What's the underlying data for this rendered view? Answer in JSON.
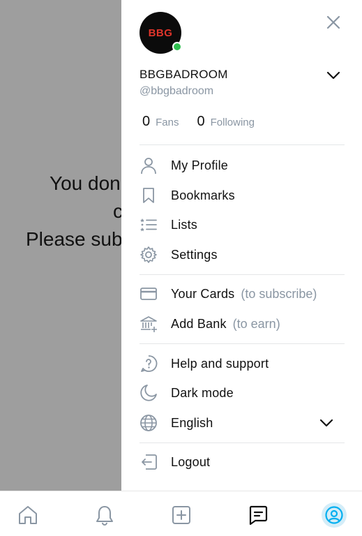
{
  "background": {
    "line1": "You don",
    "line2": "c",
    "line3": "Please sub"
  },
  "drawer": {
    "avatar_text": "BBG",
    "display_name": "BBGBADROOM",
    "username": "@bbgbadroom",
    "stats": {
      "fans_count": "0",
      "fans_label": "Fans",
      "following_count": "0",
      "following_label": "Following"
    },
    "menu": {
      "my_profile": "My Profile",
      "bookmarks": "Bookmarks",
      "lists": "Lists",
      "settings": "Settings",
      "your_cards": "Your Cards",
      "your_cards_sub": "(to subscribe)",
      "add_bank": "Add Bank",
      "add_bank_sub": "(to earn)",
      "help": "Help and support",
      "dark_mode": "Dark mode",
      "language": "English",
      "logout": "Logout"
    }
  },
  "colors": {
    "accent": "#00aff0",
    "muted_text": "#8a96a3",
    "online": "#2fbf4f",
    "overlay": "#9e9e9e"
  },
  "tabbar": {
    "icons": [
      "home-icon",
      "bell-icon",
      "plus-square-icon",
      "message-icon",
      "profile-icon"
    ],
    "active": "profile-icon"
  }
}
